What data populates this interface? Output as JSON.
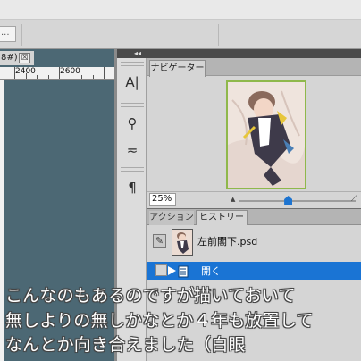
{
  "toolbar": {
    "field_text": "..."
  },
  "document": {
    "tab_label": "8#)",
    "close_glyph": "☒",
    "ruler": {
      "labels": [
        "2400",
        "2600"
      ]
    }
  },
  "dock": {
    "collapse_glyph": "◂◂"
  },
  "tools": [
    {
      "name": "character-icon",
      "glyph": "A|"
    },
    {
      "name": "brush-preset-icon",
      "glyph": "⚲"
    },
    {
      "name": "adjust-icon",
      "glyph": "≂"
    },
    {
      "name": "paragraph-icon",
      "glyph": "¶"
    }
  ],
  "navigator": {
    "tab_label": "ナビゲーター",
    "zoom_value": "25%",
    "zoom_level": 0.42,
    "zoom_small_icon": "▲",
    "zoom_large_icon": "⟋"
  },
  "history": {
    "tabs": {
      "actions": "アクション",
      "history": "ヒストリー"
    },
    "snapshot_label": "左前閣下.psd",
    "open_label": "開く"
  },
  "caption": {
    "lines": [
      "こんなのもあるのですが描いておいて",
      "無しよりの無しかなとか４年も放置して",
      "なんとか向き合えました（白眼"
    ]
  },
  "colors": {
    "selection": "#1a74d4",
    "thumbnail_border": "#8fb84b",
    "canvas": "#4c6874"
  }
}
